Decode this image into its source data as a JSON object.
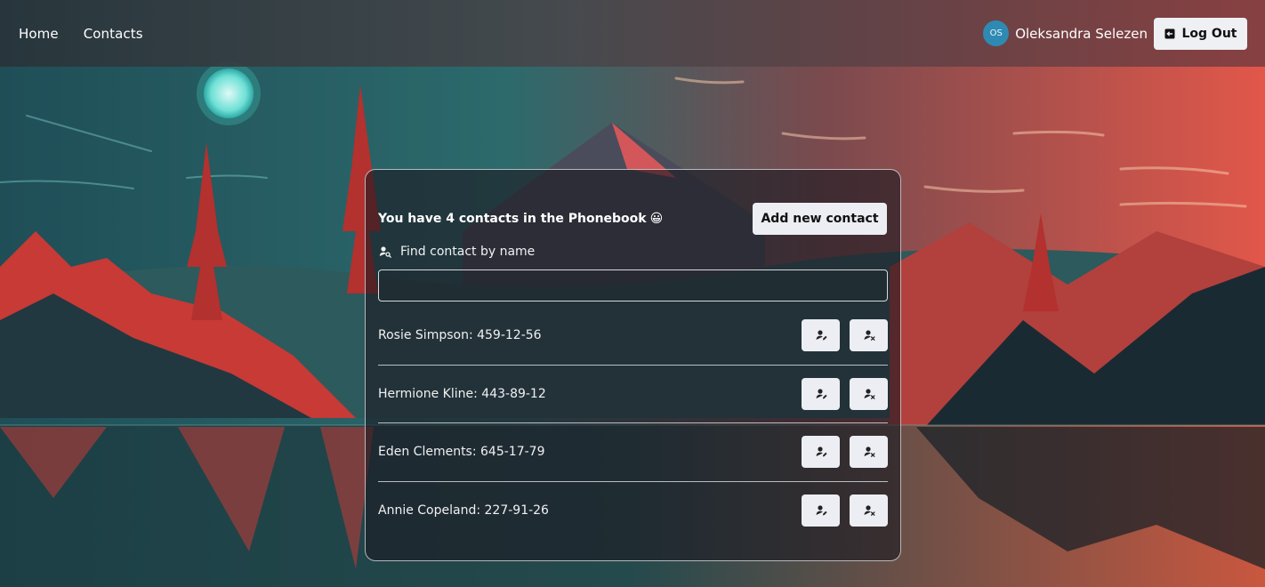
{
  "colors": {
    "accent_avatar": "#2f8ab3",
    "button_bg": "#eceef3",
    "panel_border": "#e6e6eb"
  },
  "header": {
    "nav": [
      {
        "label": "Home"
      },
      {
        "label": "Contacts"
      }
    ],
    "user": {
      "initials": "OS",
      "name": "Oleksandra Selezen"
    },
    "logout_label": "Log Out",
    "logout_icon": "logout-icon"
  },
  "phonebook": {
    "headline": "You have 4 contacts in the Phonebook",
    "headline_emoji": "😀",
    "add_button_label": "Add new contact",
    "find_label": "Find contact by name",
    "find_icon": "user-search-icon",
    "search_value": "",
    "search_placeholder": "",
    "contacts": [
      {
        "text": "Rosie Simpson: 459-12-56"
      },
      {
        "text": "Hermione Kline: 443-89-12"
      },
      {
        "text": "Eden Clements: 645-17-79"
      },
      {
        "text": "Annie Copeland: 227-91-26"
      }
    ],
    "edit_icon": "edit-contact-icon",
    "delete_icon": "delete-contact-icon"
  }
}
